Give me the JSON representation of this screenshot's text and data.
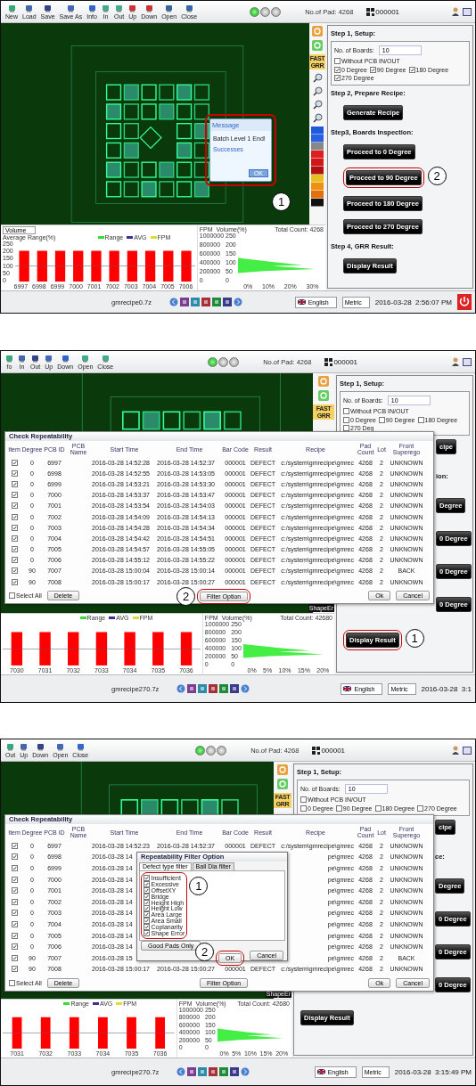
{
  "screenshots": [
    {
      "toolbar": [
        {
          "label": "New"
        },
        {
          "label": "Load"
        },
        {
          "label": "Save"
        },
        {
          "label": "Save As"
        },
        {
          "label": "Info"
        },
        {
          "label": "In"
        },
        {
          "label": "Out"
        },
        {
          "label": "Up"
        },
        {
          "label": "Down"
        },
        {
          "label": "Open"
        },
        {
          "label": "Close"
        }
      ],
      "lights": [
        {
          "on": true
        },
        {
          "on": false
        },
        {
          "on": false
        }
      ],
      "pad_count": "No.of Pad: 4268",
      "barcode": "000001",
      "fast_grr": "FAST GRR",
      "setup": {
        "title": "Step 1, Setup:",
        "boards_label": "No. of Boards:",
        "boards_value": "10",
        "pcb_option": {
          "label": "Without PCB IN/OUT",
          "checked": false
        },
        "degrees": [
          {
            "label": "0 Degree",
            "checked": true
          },
          {
            "label": "90 Degree",
            "checked": true
          },
          {
            "label": "180 Degree",
            "checked": true
          },
          {
            "label": "270 Degree",
            "checked": true
          }
        ]
      },
      "steps": [
        {
          "kind": "heading",
          "text": "Step 2, Prepare Recipe:"
        },
        {
          "kind": "button",
          "text": "Generate Recipe"
        },
        {
          "kind": "heading",
          "text": "Step3, Boards Inspection:"
        },
        {
          "kind": "button",
          "text": "Proceed to 0 Degree"
        },
        {
          "kind": "button",
          "text": "Proceed to 90 Degree",
          "callout": "2"
        },
        {
          "kind": "button",
          "text": "Proceed to 180 Degree"
        },
        {
          "kind": "button",
          "text": "Proceed to 270 Degree"
        },
        {
          "kind": "heading",
          "text": "Step 4, GRR Result:"
        },
        {
          "kind": "button",
          "text": "Display Result"
        }
      ],
      "bar_chart": {
        "dropdown": "Volume",
        "title": "Average Range(%)",
        "legend": [
          {
            "label": "Range",
            "color": "#33dd33"
          },
          {
            "label": "AVG",
            "color": "#333399"
          },
          {
            "label": "FPM",
            "color": "#dddd33"
          }
        ],
        "y_ticks": [
          "250",
          "200",
          "150",
          "100",
          "50",
          "0"
        ],
        "xlabels": [
          "6997",
          "6998",
          "6999",
          "7000",
          "7001",
          "7002",
          "7003",
          "7004",
          "7005",
          "7006"
        ]
      },
      "histogram": {
        "fpm_label": "FPM",
        "volume_label": "Volume(%)",
        "total": "Total Count: 4268",
        "fpm_ticks": [
          "1000000",
          "800000",
          "600000",
          "400000",
          "200000",
          "0"
        ],
        "volume_ticks": [
          "250",
          "200",
          "150",
          "100",
          "50",
          "0"
        ],
        "x_ticks": [
          "0%",
          "10%",
          "20%",
          "30%"
        ]
      },
      "status": {
        "file": "gmrecipe0.7z",
        "language": "English",
        "unit": "Metric",
        "datetime": "2016-03-28  2:56:07 PM"
      },
      "message": {
        "title": "Message",
        "text": "Batch Level 1 End!",
        "note": "Successes",
        "button": "OK",
        "callout": "1"
      }
    },
    {
      "toolbar": [
        {
          "label": "fo"
        },
        {
          "label": "In"
        },
        {
          "label": "Out"
        },
        {
          "label": "Up"
        },
        {
          "label": "Down"
        },
        {
          "label": "Open"
        },
        {
          "label": "Close"
        }
      ],
      "lights": [
        {
          "on": true
        },
        {
          "on": false
        },
        {
          "on": false
        }
      ],
      "pad_count": "No.of Pad: 4268",
      "barcode": "000001",
      "fast_grr": "FAST GRR",
      "shape_tag": "ShapeEr",
      "setup": {
        "title": "Step 1, Setup:",
        "boards_label": "No. of Boards:",
        "boards_value": "10",
        "pcb_option": {
          "label": "Without PCB IN/OUT",
          "checked": false
        },
        "degrees": [
          {
            "label": "0 Degree",
            "checked": false
          },
          {
            "label": "90 Degree",
            "checked": false
          },
          {
            "label": "180 Degree",
            "checked": false
          },
          {
            "label": "270 Deg",
            "checked": false
          }
        ]
      },
      "steps": [
        {
          "kind": "button",
          "text": "cipe"
        },
        {
          "kind": "heading",
          "text": "ion:"
        },
        {
          "kind": "button",
          "text": "Degree"
        },
        {
          "kind": "button",
          "text": "0 Degree"
        },
        {
          "kind": "button",
          "text": "0 Degree"
        },
        {
          "kind": "button",
          "text": "0 Degree"
        },
        {
          "kind": "button",
          "text": "Display Result",
          "callout": "1"
        }
      ],
      "bar_chart": {
        "legend": [
          {
            "label": "Range",
            "color": "#33dd33"
          },
          {
            "label": "AVG",
            "color": "#333399"
          },
          {
            "label": "FPM",
            "color": "#dddd33"
          }
        ],
        "xlabels": [
          "7030",
          "7031",
          "7032",
          "7033",
          "7034",
          "7035",
          "7036"
        ]
      },
      "histogram": {
        "fpm_label": "FPM",
        "volume_label": "Volume(%)",
        "total": "Total Count: 42680",
        "fpm_ticks": [
          "1000000",
          "800000",
          "600000",
          "400000",
          "200000",
          "0"
        ],
        "volume_ticks": [
          "250",
          "200",
          "150",
          "100",
          "50",
          "0"
        ],
        "x_ticks": [
          "0%",
          "5%",
          "10%",
          "15%",
          "20%"
        ]
      },
      "status": {
        "file": "gmrecipe270.7z",
        "language": "English",
        "unit": "Metric",
        "datetime": "2016-03-28  3:1"
      },
      "repeatability": {
        "title": "Check Repeatability",
        "columns": [
          "Item",
          "Degree",
          "PCB ID",
          "PCB Name",
          "Start Time",
          "End Time",
          "Bar Code",
          "Result",
          "Recipe",
          "Pad Count",
          "Lot",
          "Front Superego"
        ],
        "rows": [
          {
            "checked": true,
            "degree": "0",
            "pcb_id": "6997",
            "start": "2016-03-28 14:52:28",
            "end": "2016-03-28 14:52:37",
            "bar_code": "000001",
            "result": "DEFECT",
            "recipe": "c:/system\\gmrecipe\\gmrec",
            "pad_count": "4268",
            "lot": "2",
            "front": "UNKNOWN"
          },
          {
            "checked": true,
            "degree": "0",
            "pcb_id": "6998",
            "start": "2016-03-28 14:52:55",
            "end": "2016-03-28 14:53:05",
            "bar_code": "000001",
            "result": "DEFECT",
            "recipe": "c:/system\\gmrecipe\\gmrec",
            "pad_count": "4268",
            "lot": "2",
            "front": "UNKNOWN"
          },
          {
            "checked": true,
            "degree": "0",
            "pcb_id": "6999",
            "start": "2016-03-28 14:53:21",
            "end": "2016-03-28 14:53:30",
            "bar_code": "000001",
            "result": "DEFECT",
            "recipe": "c:/system\\gmrecipe\\gmrec",
            "pad_count": "4268",
            "lot": "2",
            "front": "UNKNOWN"
          },
          {
            "checked": true,
            "degree": "0",
            "pcb_id": "7000",
            "start": "2016-03-28 14:53:37",
            "end": "2016-03-28 14:53:47",
            "bar_code": "000001",
            "result": "DEFECT",
            "recipe": "c:/system\\gmrecipe\\gmrec",
            "pad_count": "4268",
            "lot": "2",
            "front": "UNKNOWN"
          },
          {
            "checked": true,
            "degree": "0",
            "pcb_id": "7001",
            "start": "2016-03-28 14:53:54",
            "end": "2016-03-28 14:54:03",
            "bar_code": "000001",
            "result": "DEFECT",
            "recipe": "c:/system\\gmrecipe\\gmrec",
            "pad_count": "4268",
            "lot": "2",
            "front": "UNKNOWN"
          },
          {
            "checked": true,
            "degree": "0",
            "pcb_id": "7002",
            "start": "2016-03-28 14:54:09",
            "end": "2016-03-28 14:54:13",
            "bar_code": "000001",
            "result": "DEFECT",
            "recipe": "c:/system\\gmrecipe\\gmrec",
            "pad_count": "4268",
            "lot": "2",
            "front": "UNKNOWN"
          },
          {
            "checked": true,
            "degree": "0",
            "pcb_id": "7003",
            "start": "2016-03-28 14:54:28",
            "end": "2016-03-28 14:54:34",
            "bar_code": "000001",
            "result": "DEFECT",
            "recipe": "c:/system\\gmrecipe\\gmrec",
            "pad_count": "4268",
            "lot": "2",
            "front": "UNKNOWN"
          },
          {
            "checked": true,
            "degree": "0",
            "pcb_id": "7004",
            "start": "2016-03-28 14:54:42",
            "end": "2016-03-28 14:54:51",
            "bar_code": "000001",
            "result": "DEFECT",
            "recipe": "c:/system\\gmrecipe\\gmrec",
            "pad_count": "4268",
            "lot": "2",
            "front": "UNKNOWN"
          },
          {
            "checked": true,
            "degree": "0",
            "pcb_id": "7005",
            "start": "2016-03-28 14:54:57",
            "end": "2016-03-28 14:55:05",
            "bar_code": "000001",
            "result": "DEFECT",
            "recipe": "c:/system\\gmrecipe\\gmrec",
            "pad_count": "4268",
            "lot": "2",
            "front": "UNKNOWN"
          },
          {
            "checked": true,
            "degree": "0",
            "pcb_id": "7006",
            "start": "2016-03-28 14:55:12",
            "end": "2016-03-28 14:55:22",
            "bar_code": "000001",
            "result": "DEFECT",
            "recipe": "c:/system\\gmrecipe\\gmrec",
            "pad_count": "4268",
            "lot": "2",
            "front": "UNKNOWN"
          },
          {
            "checked": true,
            "degree": "90",
            "pcb_id": "7007",
            "start": "2016-03-28 15:00:04",
            "end": "2016-03-28 15:00:14",
            "bar_code": "000001",
            "result": "DEFECT",
            "recipe": "c:/system\\gmrecipe\\gmrec",
            "pad_count": "4268",
            "lot": "2",
            "front": "BACK"
          },
          {
            "checked": true,
            "degree": "90",
            "pcb_id": "7008",
            "start": "2016-03-28 15:00:17",
            "end": "2016-03-28 15:00:27",
            "bar_code": "000001",
            "result": "DEFECT",
            "recipe": "c:/system\\gmrecipe\\gmrec",
            "pad_count": "4268",
            "lot": "2",
            "front": "UNKNOWN"
          }
        ],
        "select_all": {
          "label": "Select All",
          "checked": false
        },
        "delete": "Delete",
        "filter": {
          "label": "Filter Option",
          "callout": "2"
        },
        "ok": "Ok",
        "cancel": "Cancel"
      }
    },
    {
      "toolbar": [
        {
          "label": "Out"
        },
        {
          "label": "Up"
        },
        {
          "label": "Down"
        },
        {
          "label": "Open"
        },
        {
          "label": "Close"
        }
      ],
      "lights": [
        {
          "on": true
        },
        {
          "on": false
        },
        {
          "on": false
        }
      ],
      "pad_count": "No.of Pad: 4268",
      "barcode": "000001",
      "fast_grr": "FAST GRR",
      "shape_tag": "ShapeEr",
      "setup": {
        "title": "Step 1, Setup:",
        "boards_label": "No. of Boards:",
        "boards_value": "10",
        "pcb_option": {
          "label": "Without PCB IN/OUT",
          "checked": false
        },
        "degrees": [
          {
            "label": "0 Degree",
            "checked": false
          },
          {
            "label": "90 Degree",
            "checked": false
          },
          {
            "label": "180 Degree",
            "checked": false
          },
          {
            "label": "270 Degree",
            "checked": false
          }
        ]
      },
      "steps": [
        {
          "kind": "button",
          "text": "cipe"
        },
        {
          "kind": "heading",
          "text": "ce:"
        },
        {
          "kind": "button",
          "text": "Degree"
        },
        {
          "kind": "button",
          "text": "0 Degree"
        },
        {
          "kind": "button",
          "text": "0 Degree"
        },
        {
          "kind": "button",
          "text": "0 Degree"
        },
        {
          "kind": "button",
          "text": "Display Result"
        }
      ],
      "bar_chart": {
        "legend": [
          {
            "label": "Range",
            "color": "#33dd33"
          },
          {
            "label": "AVG",
            "color": "#333399"
          },
          {
            "label": "FPM",
            "color": "#dddd33"
          }
        ],
        "xlabels": [
          "7031",
          "7032",
          "7033",
          "7034",
          "7035",
          "7036"
        ]
      },
      "histogram": {
        "fpm_label": "FPM",
        "volume_label": "Volume(%)",
        "total": "Total Count: 42680",
        "fpm_ticks": [
          "1000000",
          "800000",
          "600000",
          "400000",
          "200000",
          "0"
        ],
        "volume_ticks": [
          "250",
          "200",
          "150",
          "100",
          "50",
          "0"
        ],
        "x_ticks": [
          "0%",
          "5%",
          "10%",
          "15%",
          "20%"
        ]
      },
      "status": {
        "file": "gmrecipe270.7z",
        "language": "English",
        "unit": "Metric",
        "datetime": "2016-03-28  3:15:49 PM"
      },
      "repeatability": {
        "title": "Check Repeatability",
        "columns": [
          "Item",
          "Degree",
          "PCB ID",
          "PCB Name",
          "Start Time",
          "End Time",
          "Bar Code",
          "Result",
          "Recipe",
          "Pad Count",
          "Lot",
          "Front Superego"
        ],
        "rows": [
          {
            "checked": true,
            "degree": "0",
            "pcb_id": "6997",
            "start": "2016-03-28 14:52:23",
            "end": "2016-03-28 14:52:37",
            "bar_code": "000001",
            "result": "DEFECT",
            "recipe": "c:/system\\gmrecipe\\gmrec",
            "pad_count": "4268",
            "lot": "2",
            "front": "UNKNOWN"
          },
          {
            "checked": true,
            "degree": "0",
            "pcb_id": "6998",
            "start": "2016-03-28 14",
            "recipe": "pe\\gmrec",
            "pad_count": "4268",
            "lot": "2",
            "front": "UNKNOWN"
          },
          {
            "checked": true,
            "degree": "0",
            "pcb_id": "6999",
            "start": "2016-03-28 14",
            "recipe": "pe\\gmrec",
            "pad_count": "4268",
            "lot": "2",
            "front": "UNKNOWN"
          },
          {
            "checked": true,
            "degree": "0",
            "pcb_id": "7000",
            "start": "2016-03-28 14",
            "recipe": "pe\\gmrec",
            "pad_count": "4268",
            "lot": "2",
            "front": "UNKNOWN"
          },
          {
            "checked": true,
            "degree": "0",
            "pcb_id": "7001",
            "start": "2016-03-28 14",
            "recipe": "pe\\gmrec",
            "pad_count": "4268",
            "lot": "2",
            "front": "UNKNOWN"
          },
          {
            "checked": true,
            "degree": "0",
            "pcb_id": "7002",
            "start": "2016-03-28 14",
            "recipe": "pe\\gmrec",
            "pad_count": "4268",
            "lot": "2",
            "front": "UNKNOWN"
          },
          {
            "checked": true,
            "degree": "0",
            "pcb_id": "7003",
            "start": "2016-03-28 14",
            "recipe": "pe\\gmrec",
            "pad_count": "4268",
            "lot": "2",
            "front": "UNKNOWN"
          },
          {
            "checked": true,
            "degree": "0",
            "pcb_id": "7004",
            "start": "2016-03-28 14",
            "recipe": "pe\\gmrec",
            "pad_count": "4268",
            "lot": "2",
            "front": "UNKNOWN"
          },
          {
            "checked": true,
            "degree": "0",
            "pcb_id": "7005",
            "start": "2016-03-28 14",
            "recipe": "pe\\gmrec",
            "pad_count": "4268",
            "lot": "2",
            "front": "UNKNOWN"
          },
          {
            "checked": true,
            "degree": "0",
            "pcb_id": "7006",
            "start": "2016-03-28 14",
            "recipe": "pe\\gmrec",
            "pad_count": "4268",
            "lot": "2",
            "front": "UNKNOWN"
          },
          {
            "checked": true,
            "degree": "90",
            "pcb_id": "7007",
            "start": "2016-03-28 15",
            "recipe": "pe\\gmrec",
            "pad_count": "4268",
            "lot": "2",
            "front": "BACK"
          },
          {
            "checked": true,
            "degree": "90",
            "pcb_id": "7008",
            "start": "2016-03-28 15:00:17",
            "end": "2016-03-28 15:00:27",
            "bar_code": "000001",
            "result": "DEFECT",
            "recipe": "c:/system\\gmrecipe\\gmrec",
            "pad_count": "4268",
            "lot": "2",
            "front": "UNKNOWN"
          }
        ],
        "select_all": {
          "label": "Select All",
          "checked": false
        },
        "delete": "Delete",
        "filter": {
          "label": "Filter Option"
        },
        "ok": "Ok",
        "cancel": "Cancel"
      },
      "filter_dialog": {
        "title": "Repeatability Filter Option",
        "tabs": [
          {
            "label": "Defect type filter",
            "selected": true
          },
          {
            "label": "Ball Dia filter",
            "selected": false
          }
        ],
        "defects": [
          {
            "label": "Insufficient",
            "checked": true
          },
          {
            "label": "Excessive",
            "checked": true
          },
          {
            "label": "OffsetXY",
            "checked": true
          },
          {
            "label": "Bridge",
            "checked": true
          },
          {
            "label": "Height High",
            "checked": true
          },
          {
            "label": "Height Low",
            "checked": true
          },
          {
            "label": "Area Large",
            "checked": true
          },
          {
            "label": "Area Small",
            "checked": true
          },
          {
            "label": "Coplanarity",
            "checked": true
          },
          {
            "label": "Shape Error",
            "checked": true
          }
        ],
        "callout": "1",
        "good_pads": "Good Pads Only",
        "ok": {
          "label": "OK",
          "callout": "2"
        },
        "cancel": "Cancel"
      }
    }
  ]
}
